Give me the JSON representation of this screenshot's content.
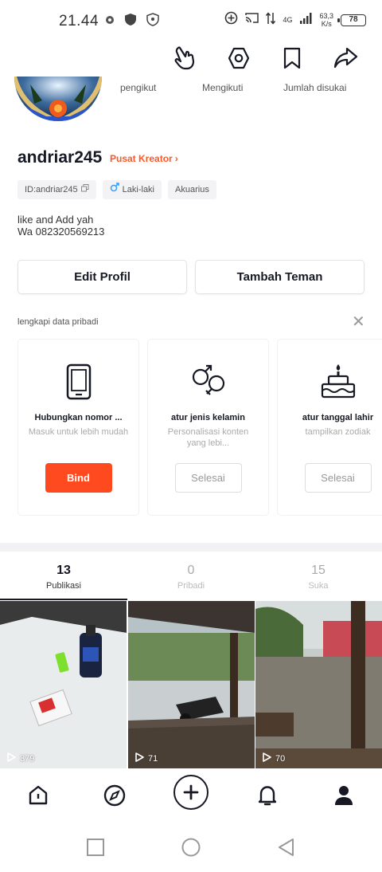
{
  "status_bar": {
    "time": "21.44",
    "net_speed": "63,3",
    "net_unit": "K/s",
    "network_type": "4G",
    "battery": "78"
  },
  "header_actions": {
    "icons": [
      "hand-pointer-icon",
      "settings-hexagon-icon",
      "bookmark-icon",
      "share-icon"
    ]
  },
  "stats": {
    "followers_label": "pengikut",
    "following_label": "Mengikuti",
    "likes_label": "Jumlah disukai"
  },
  "profile": {
    "username": "andriar245",
    "creator_link": "Pusat Kreator",
    "tags": {
      "id": "ID:andriar245",
      "gender": "Laki-laki",
      "zodiac": "Akuarius"
    },
    "bio_line1": "like and Add yah",
    "bio_line2": "Wa 082320569213"
  },
  "buttons": {
    "edit_profile": "Edit Profil",
    "add_friend": "Tambah Teman"
  },
  "complete_data": {
    "title": "lengkapi data pribadi",
    "cards": [
      {
        "title": "Hubungkan nomor ...",
        "subtitle": "Masuk untuk lebih mudah",
        "button": "Bind",
        "icon": "phone-icon"
      },
      {
        "title": "atur jenis kelamin",
        "subtitle": "Personalisasi konten yang lebi...",
        "button": "Selesai",
        "icon": "gender-icon"
      },
      {
        "title": "atur tanggal lahir",
        "subtitle": "tampilkan zodiak",
        "button": "Selesai",
        "icon": "birthday-cake-icon"
      }
    ]
  },
  "tabs": [
    {
      "count": "13",
      "label": "Publikasi"
    },
    {
      "count": "0",
      "label": "Pribadi"
    },
    {
      "count": "15",
      "label": "Suka"
    }
  ],
  "videos": [
    {
      "views": "379"
    },
    {
      "views": "71"
    },
    {
      "views": "70"
    }
  ],
  "bottom_nav": [
    "home-icon",
    "discover-icon",
    "create-plus-icon",
    "notifications-bell-icon",
    "profile-icon"
  ],
  "colors": {
    "accent": "#fe5722",
    "primary_button": "#fe4a1e",
    "text": "#161823"
  }
}
